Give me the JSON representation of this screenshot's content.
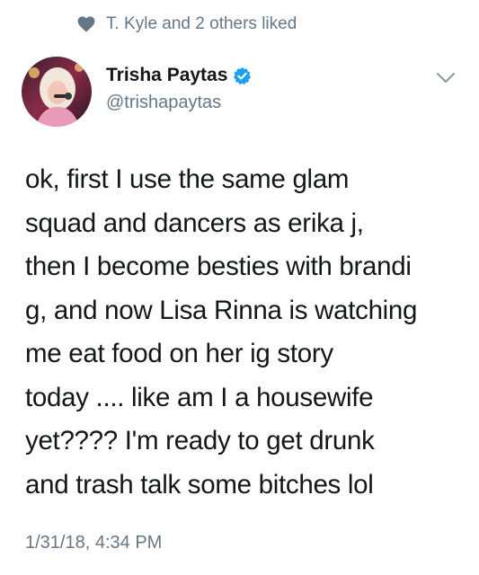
{
  "social_context": {
    "icon": "heart-icon",
    "text": "T. Kyle and 2 others liked"
  },
  "author": {
    "name": "Trisha Paytas",
    "handle": "@trishapaytas",
    "verified": true,
    "avatar_icon": "avatar"
  },
  "menu": {
    "icon": "chevron-down-icon"
  },
  "tweet": {
    "lines": [
      "ok, first I use the same glam",
      "squad and dancers as erika j,",
      "then I become besties with brandi",
      "g, and now Lisa Rinna is watching",
      "me eat food on her ig story",
      "today .... like am I a housewife",
      "yet???? I'm ready to get drunk",
      "and trash talk some bitches lol"
    ],
    "timestamp": "1/31/18, 4:34 PM"
  },
  "colors": {
    "text": "#14171a",
    "secondary": "#657786",
    "verified": "#1da1f2"
  }
}
